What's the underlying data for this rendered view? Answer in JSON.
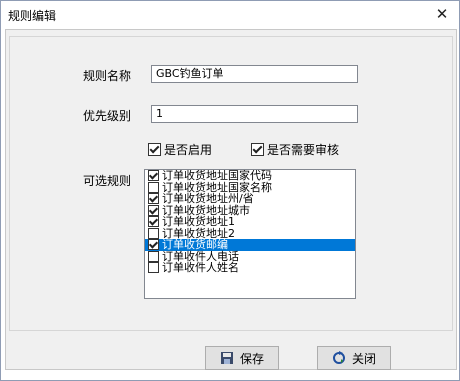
{
  "window": {
    "title": "规则编辑",
    "close_glyph": "✕"
  },
  "form": {
    "rule_name_label": "规则名称",
    "rule_name_value": "GBC钓鱼订单",
    "priority_label": "优先级别",
    "priority_value": "1",
    "enabled_label": "是否启用",
    "enabled_checked": true,
    "need_review_label": "是否需要审核",
    "need_review_checked": true,
    "optional_rules_label": "可选规则"
  },
  "rules": [
    {
      "label": "订单收货地址国家代码",
      "checked": true,
      "selected": false
    },
    {
      "label": "订单收货地址国家名称",
      "checked": false,
      "selected": false
    },
    {
      "label": "订单收货地址州/省",
      "checked": true,
      "selected": false
    },
    {
      "label": "订单收货地址城市",
      "checked": true,
      "selected": false
    },
    {
      "label": "订单收货地址1",
      "checked": true,
      "selected": false
    },
    {
      "label": "订单收货地址2",
      "checked": false,
      "selected": false
    },
    {
      "label": "订单收货邮编",
      "checked": true,
      "selected": true
    },
    {
      "label": "订单收件人电话",
      "checked": false,
      "selected": false
    },
    {
      "label": "订单收件人姓名",
      "checked": false,
      "selected": false
    }
  ],
  "buttons": {
    "save_label": "保存",
    "close_label": "关闭"
  },
  "icons": {
    "save": "save-icon",
    "close": "refresh-close-icon"
  }
}
